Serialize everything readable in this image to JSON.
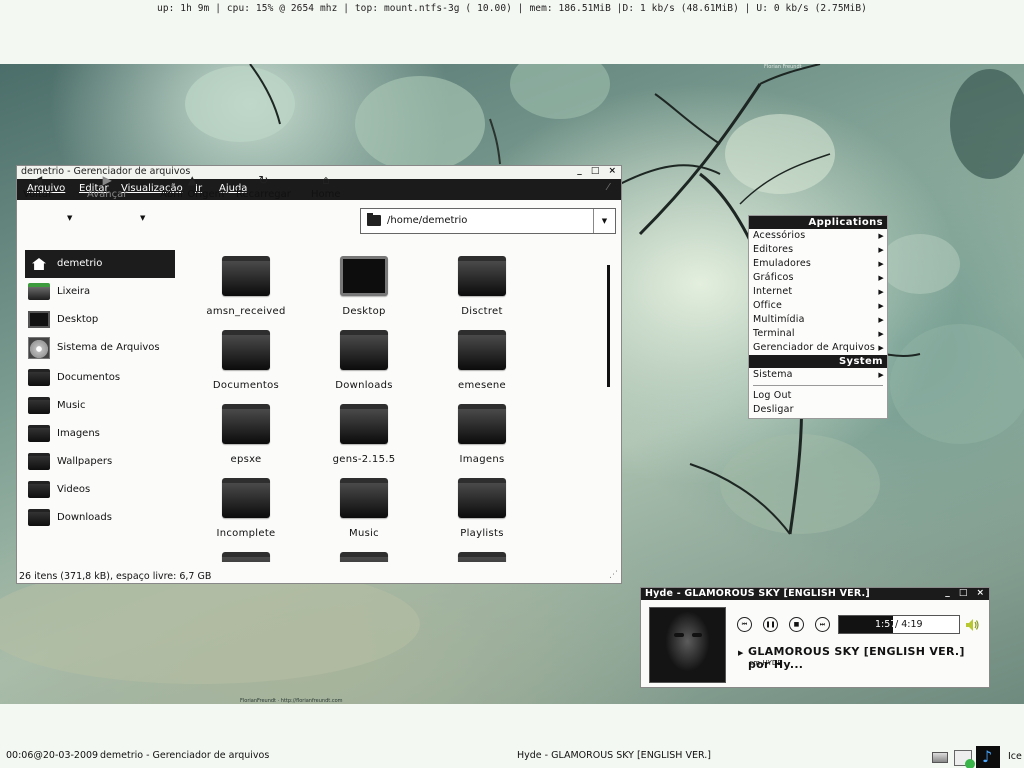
{
  "topbar": {
    "status": "up: 1h 9m | cpu: 15% @ 2654 mhz | top: mount.ntfs-3g ( 10.00) | mem: 186.51MiB |D: 1 kb/s (48.61MiB) | U: 0 kb/s (2.75MiB)"
  },
  "wallpaper": {
    "credit": "FlorianFreundt · http://florianfreundt.com",
    "credit_top": "Florian Freundt"
  },
  "file_manager": {
    "title": "demetrio - Gerenciador de arquivos",
    "menu": [
      "Arquivo",
      "Editar",
      "Visualização",
      "Ir",
      "Ajuda"
    ],
    "toolbar": {
      "back": "Voltar",
      "forward": "Avançar",
      "up": "Abrir Origem",
      "reload": "Recarregar",
      "home": "Home"
    },
    "location": "/home/demetrio",
    "sidebar": [
      {
        "label": "demetrio",
        "icon": "home-icon",
        "active": true
      },
      {
        "label": "Lixeira",
        "icon": "trash-icon"
      },
      {
        "label": "Desktop",
        "icon": "desktop-icon"
      },
      {
        "label": "Sistema de Arquivos",
        "icon": "drive-icon"
      },
      {
        "label": "Documentos",
        "icon": "folder-icon"
      },
      {
        "label": "Music",
        "icon": "folder-icon"
      },
      {
        "label": "Imagens",
        "icon": "folder-icon"
      },
      {
        "label": "Wallpapers",
        "icon": "folder-icon"
      },
      {
        "label": "Videos",
        "icon": "folder-icon"
      },
      {
        "label": "Downloads",
        "icon": "folder-icon"
      }
    ],
    "items": [
      "amsn_received",
      "Desktop",
      "Disctret",
      "Documentos",
      "Downloads",
      "emesene",
      "epsxe",
      "gens-2.15.5",
      "Imagens",
      "Incomplete",
      "Music",
      "Playlists",
      "",
      "",
      ""
    ],
    "status": "26 itens (371,8 kB), espaço livre: 6,7 GB"
  },
  "menu": {
    "header_apps": "Applications",
    "apps": [
      "Acessórios",
      "Editores",
      "Emuladores",
      "Gráficos",
      "Internet",
      "Office",
      "Multimídia",
      "Terminal",
      "Gerenciador de Arquivos"
    ],
    "header_system": "System",
    "system": "Sistema",
    "logout": "Log Out",
    "shutdown": "Desligar"
  },
  "player": {
    "title": "Hyde - GLAMOROUS SKY [ENGLISH VER.]",
    "song": "GLAMOROUS SKY [ENGLISH VER.] por Hy...",
    "album": "em HYDE",
    "elapsed": "1:57",
    "total": "/ 4:19",
    "progress": 0.45
  },
  "taskbar": {
    "clock": "00:06@20-03-2009",
    "task1": "demetrio - Gerenciador de arquivos",
    "task2": "Hyde - GLAMOROUS SKY [ENGLISH VER.]",
    "tray_label": "Ice"
  },
  "window_buttons": "_ □ ×"
}
